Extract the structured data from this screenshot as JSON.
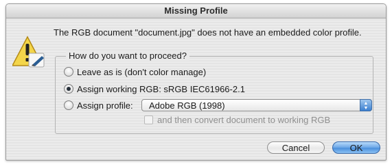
{
  "dialog": {
    "title": "Missing Profile",
    "message": "The RGB document \"document.jpg\" does not have an embedded color profile.",
    "group_title": "How do you want to proceed?",
    "options": [
      {
        "label": "Leave as is (don't color manage)",
        "selected": false
      },
      {
        "label": "Assign working RGB:  sRGB IEC61966-2.1",
        "selected": true
      },
      {
        "label": "Assign profile:",
        "selected": false
      }
    ],
    "profile_select": {
      "value": "Adobe RGB (1998)"
    },
    "convert_checkbox": {
      "label": "and then convert document to working RGB",
      "checked": false,
      "enabled": false
    },
    "buttons": {
      "cancel": "Cancel",
      "ok": "OK"
    }
  },
  "icons": {
    "alert": "caution-triangle-icon",
    "select_arrows": "up-down-arrows-icon"
  }
}
